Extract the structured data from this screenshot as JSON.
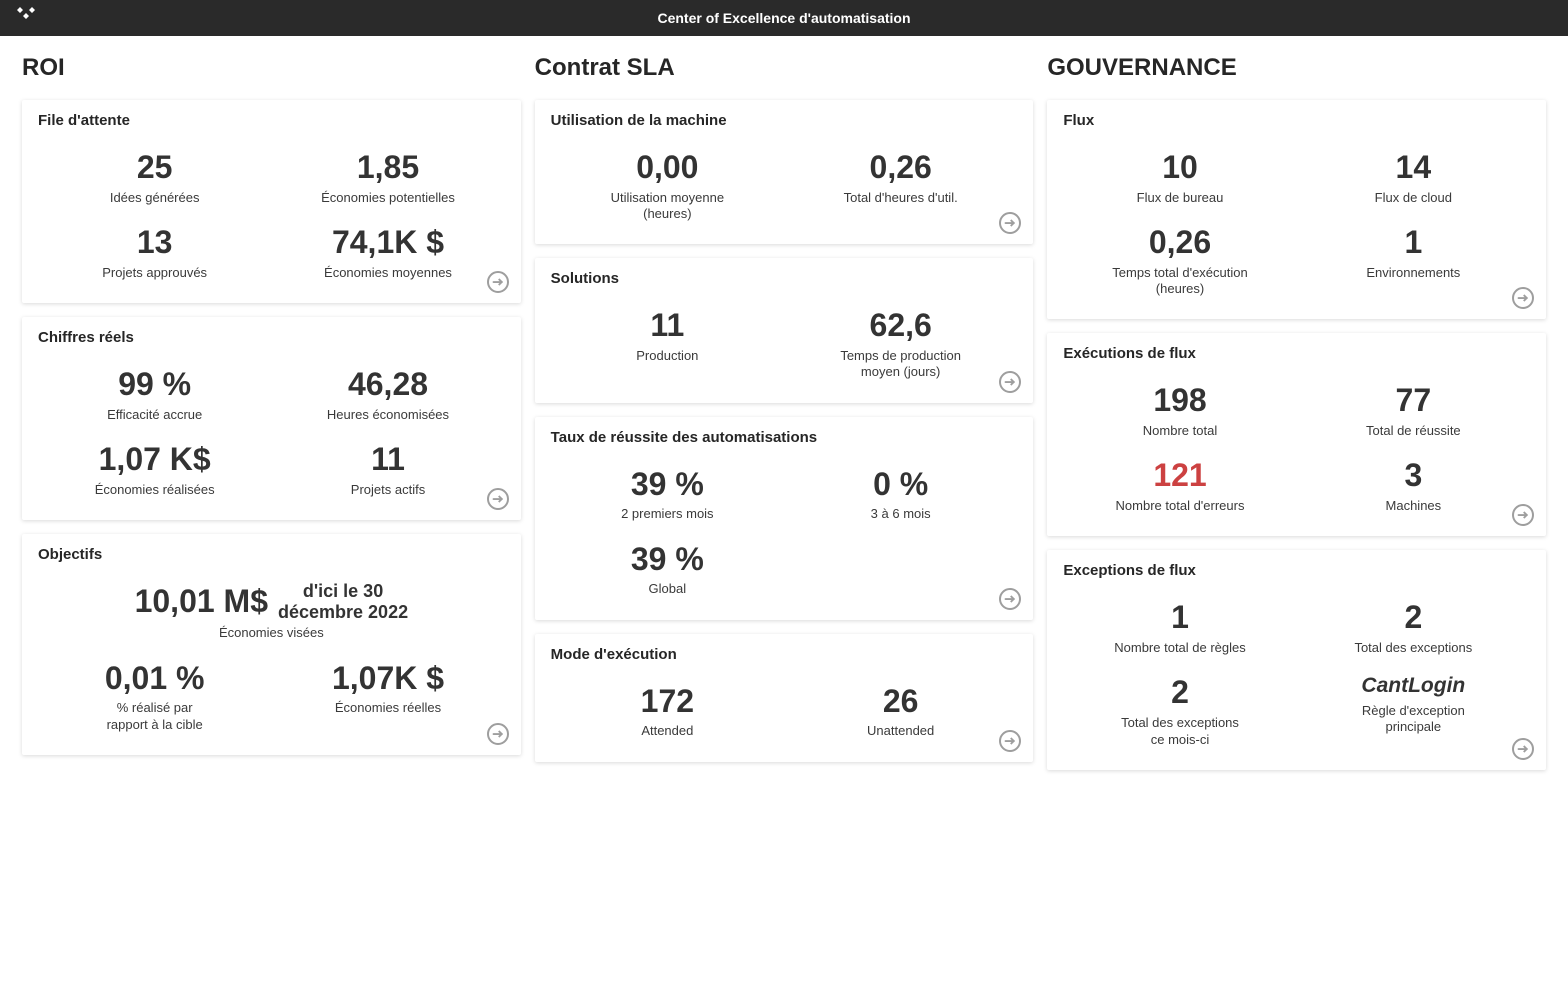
{
  "header": {
    "title": "Center of Excellence d'automatisation"
  },
  "sections": {
    "roi": {
      "title": "ROI",
      "queue": {
        "title": "File d'attente",
        "ideas_value": "25",
        "ideas_label": "Idées générées",
        "potential_value": "1,85",
        "potential_label": "Économies potentielles",
        "approved_value": "13",
        "approved_label": "Projets approuvés",
        "avg_savings_value": "74,1K $",
        "avg_savings_label": "Économies moyennes"
      },
      "actuals": {
        "title": "Chiffres réels",
        "efficiency_value": "99 %",
        "efficiency_label": "Efficacité accrue",
        "hours_value": "46,28",
        "hours_label": "Heures économisées",
        "realized_value": "1,07 K$",
        "realized_label": "Économies réalisées",
        "active_value": "11",
        "active_label": "Projets actifs"
      },
      "goals": {
        "title": "Objectifs",
        "target_value": "10,01 M$",
        "target_date_line1": "d'ici le 30",
        "target_date_line2": "décembre 2022",
        "target_label": "Économies visées",
        "pct_value": "0,01 %",
        "pct_label_line1": "% réalisé par",
        "pct_label_line2": "rapport à la cible",
        "real_value": "1,07K $",
        "real_label": "Économies réelles"
      }
    },
    "sla": {
      "title": "Contrat SLA",
      "machine": {
        "title": "Utilisation de la machine",
        "avg_value": "0,00",
        "avg_label_line1": "Utilisation moyenne",
        "avg_label_line2": "(heures)",
        "total_value": "0,26",
        "total_label": "Total d'heures d'util."
      },
      "solutions": {
        "title": "Solutions",
        "prod_value": "11",
        "prod_label": "Production",
        "time_value": "62,6",
        "time_label_line1": "Temps de production",
        "time_label_line2": "moyen (jours)"
      },
      "success": {
        "title": "Taux de réussite des automatisations",
        "first2_value": "39 %",
        "first2_label": "2 premiers mois",
        "m36_value": "0 %",
        "m36_label": "3 à 6 mois",
        "global_value": "39 %",
        "global_label": "Global"
      },
      "runmode": {
        "title": "Mode d'exécution",
        "attended_value": "172",
        "attended_label": "Attended",
        "unattended_value": "26",
        "unattended_label": "Unattended"
      }
    },
    "gov": {
      "title": "GOUVERNANCE",
      "flows": {
        "title": "Flux",
        "desktop_value": "10",
        "desktop_label": "Flux de bureau",
        "cloud_value": "14",
        "cloud_label": "Flux de cloud",
        "runtime_value": "0,26",
        "runtime_label_line1": "Temps total d'exécution",
        "runtime_label_line2": "(heures)",
        "env_value": "1",
        "env_label": "Environnements"
      },
      "runs": {
        "title": "Exécutions de flux",
        "total_value": "198",
        "total_label": "Nombre total",
        "success_value": "77",
        "success_label": "Total de réussite",
        "errors_value": "121",
        "errors_label": "Nombre total d'erreurs",
        "machines_value": "3",
        "machines_label": "Machines"
      },
      "exceptions": {
        "title": "Exceptions de flux",
        "rules_value": "1",
        "rules_label": "Nombre total de règles",
        "exc_value": "2",
        "exc_label": "Total des exceptions",
        "month_value": "2",
        "month_label_line1": "Total des exceptions",
        "month_label_line2": "ce mois-ci",
        "main_value": "CantLogin",
        "main_label_line1": "Règle d'exception",
        "main_label_line2": "principale"
      }
    }
  }
}
